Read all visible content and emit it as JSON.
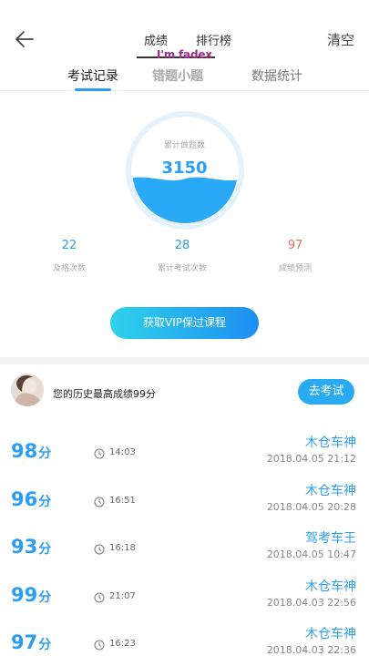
{
  "nav": {
    "tabs": [
      "成绩",
      "排行榜"
    ],
    "clear": "清空",
    "overlay": "I'm fadex"
  },
  "subtabs": [
    "考试记录",
    "错题小题",
    "数据统计"
  ],
  "gauge": {
    "label": "累计做题数",
    "value": "3150",
    "fill_fraction": 0.42,
    "colors": {
      "ring": "#e6f4fd",
      "fill": "#2aa9f6"
    }
  },
  "stats": [
    {
      "value": "22",
      "label": "及格次数"
    },
    {
      "value": "28",
      "label": "累计考试次数"
    },
    {
      "value": "97",
      "label": "成绩预测"
    }
  ],
  "vip_button": "获取VIP保过课程",
  "history": {
    "text": "您的历史最高成绩99分",
    "exam_button": "去考试"
  },
  "records": [
    {
      "score": "98",
      "unit": "分",
      "time": "14:03",
      "title": "木仓车神",
      "date": "2018.04.05  21:12"
    },
    {
      "score": "96",
      "unit": "分",
      "time": "16:51",
      "title": "木仓车神",
      "date": "2018.04.05  20:28"
    },
    {
      "score": "93",
      "unit": "分",
      "time": "16:18",
      "title": "驾考车王",
      "date": "2018.04.05  10:47"
    },
    {
      "score": "99",
      "unit": "分",
      "time": "21:07",
      "title": "木仓车神",
      "date": "2018.04.03  22:56"
    },
    {
      "score": "97",
      "unit": "分",
      "time": "16:23",
      "title": "木仓车神",
      "date": "2018.04.03  22:36"
    }
  ],
  "colors": {
    "accent": "#2a9df4",
    "predict": "#ee6a5a"
  }
}
